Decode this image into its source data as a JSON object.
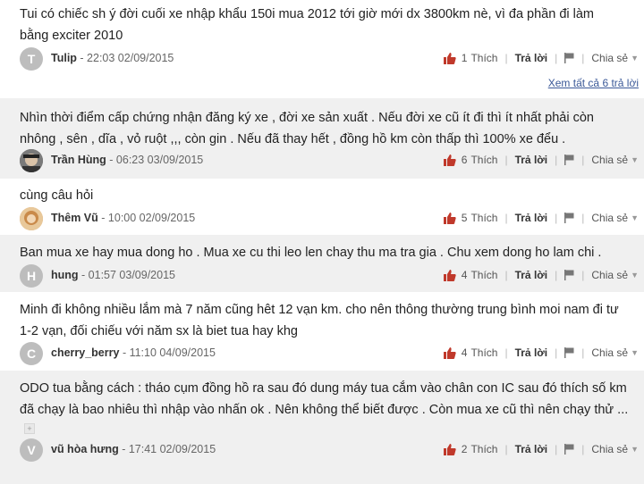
{
  "ui": {
    "like_label": "Thích",
    "reply_label": "Trả lời",
    "share_label": "Chia sẻ",
    "see_all": "Xem tất cả 6 trả lời"
  },
  "comments": [
    {
      "text": "Tui có chiếc sh ý đời cuối xe nhập khẩu 150i mua 2012 tới giờ mới dx 3800km nè, vì đa phần đi làm\nbằng exciter 2010",
      "author": "Tulip",
      "time": "- 22:03 02/09/2015",
      "likes": "1",
      "avatar_letter": "T",
      "avatar_color": "#bdbdbd"
    },
    {
      "text": "Nhìn thời điểm cấp chứng nhận đăng ký xe , đời xe sản xuất . Nếu đời xe cũ ít đi thì ít nhất phải còn\nnhông , sên , dĩa , vỏ ruột ,,, còn gin . Nếu đã thay hết , đồng hồ km còn thấp thì 100% xe đểu .",
      "author": "Trần Hùng",
      "time": "- 06:23 03/09/2015",
      "likes": "6",
      "avatar_letter": "",
      "avatar_color": "#6b6b6b"
    },
    {
      "text": "cùng câu hỏi",
      "author": "Thêm Vũ",
      "time": "- 10:00 02/09/2015",
      "likes": "5",
      "avatar_letter": "",
      "avatar_color": "#d9a066"
    },
    {
      "text": "Ban mua xe hay mua dong ho . Mua xe cu thi leo len chay thu ma tra gia . Chu xem dong ho lam chi .",
      "author": "hung",
      "time": "- 01:57 03/09/2015",
      "likes": "4",
      "avatar_letter": "H",
      "avatar_color": "#bdbdbd"
    },
    {
      "text": "Minh đi không nhiều lắm mà 7 năm cũng hêt 12 vạn km. cho nên thông thường trung bình moi nam đi tư\n1-2 vạn, đối chiếu với năm sx là biet tua hay khg",
      "author": "cherry_berry",
      "time": "- 11:10 04/09/2015",
      "likes": "4",
      "avatar_letter": "C",
      "avatar_color": "#bdbdbd"
    },
    {
      "text": "ODO tua bằng cách : tháo cụm đồng hồ ra sau đó dung máy tua cắm vào chân con IC sau đó thích số km\nđã chạy là bao nhiêu thì nhập vào nhấn ok . Nên không thể biết được . Còn mua xe cũ thì nên chạy thử ...",
      "author": "vũ hòa hưng",
      "time": "- 17:41 02/09/2015",
      "likes": "2",
      "avatar_letter": "V",
      "avatar_color": "#bdbdbd"
    }
  ]
}
